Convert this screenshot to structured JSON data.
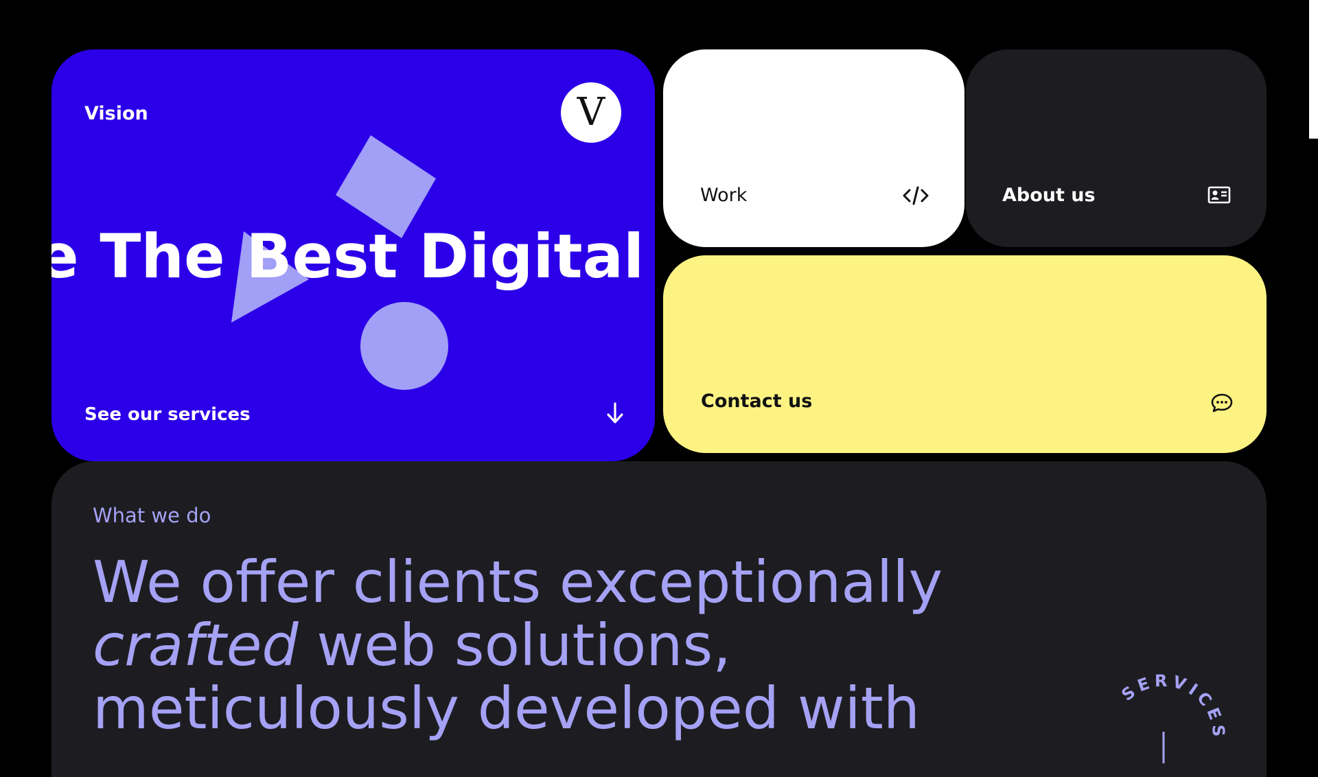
{
  "vision_card": {
    "label": "Vision",
    "logo_letter": "V",
    "marquee_text": "e The Best Digital Expe",
    "cta_label": "See our services",
    "cta_icon": "arrow-down-icon",
    "bg_color": "#2b00e8",
    "shape_color": "#a29ff7"
  },
  "work_card": {
    "label": "Work",
    "icon": "code-icon",
    "bg_color": "#ffffff"
  },
  "about_card": {
    "label": "About us",
    "icon": "id-card-icon",
    "bg_color": "#1d1d21"
  },
  "contact_card": {
    "label": "Contact us",
    "icon": "chat-bubble-icon",
    "bg_color": "#fdf383"
  },
  "what_we_do": {
    "kicker": "What we do",
    "headline_line1": "We offer clients exceptionally",
    "headline_italic": "crafted",
    "headline_line2_rest": " web solutions,",
    "headline_line3": "meticulously developed with",
    "badge_text": "SERVICES",
    "text_color": "#a5a2f5"
  }
}
